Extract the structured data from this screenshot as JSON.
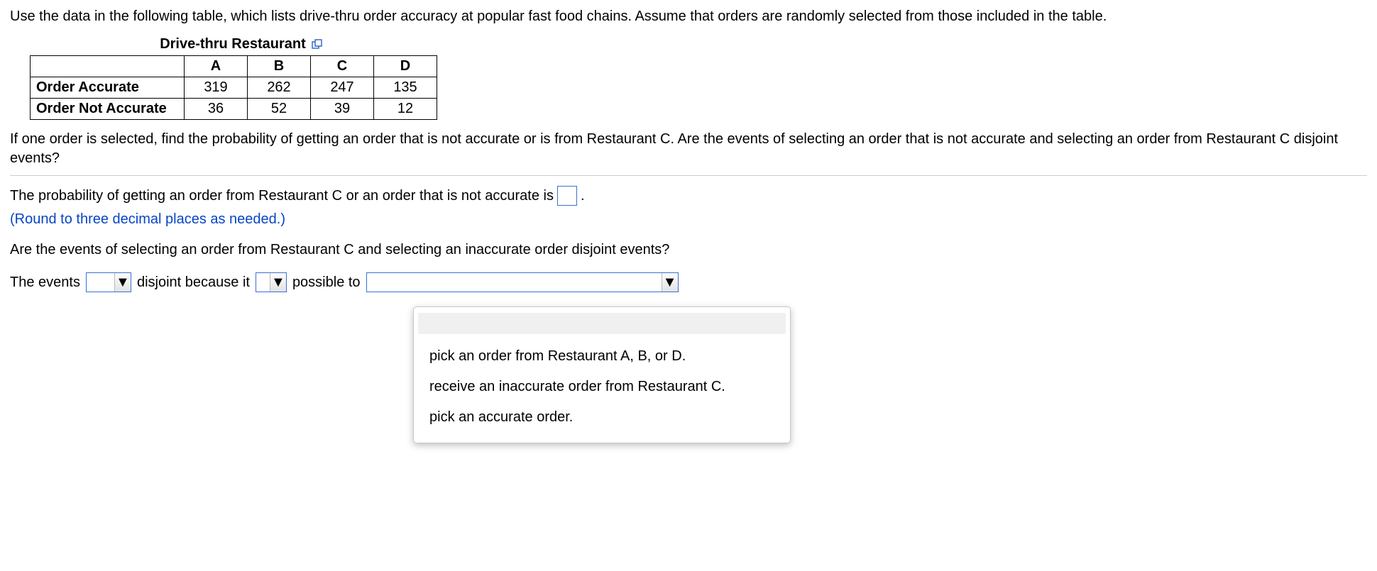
{
  "intro": "Use the data in the following table, which lists drive-thru order accuracy at popular fast food chains. Assume that orders are randomly selected from those included in the table.",
  "table": {
    "title": "Drive-thru Restaurant",
    "cols": [
      "A",
      "B",
      "C",
      "D"
    ],
    "rows": [
      {
        "label": "Order Accurate",
        "vals": [
          "319",
          "262",
          "247",
          "135"
        ]
      },
      {
        "label": "Order Not Accurate",
        "vals": [
          "36",
          "52",
          "39",
          "12"
        ]
      }
    ]
  },
  "question": "If one order is selected, find the probability of getting an order that is not accurate or is from Restaurant C. Are the events of selecting an order that is not accurate and selecting an order from Restaurant C disjoint events?",
  "answer": {
    "lead": "The probability of getting an order from Restaurant C or an order that is not accurate is",
    "trail": ".",
    "hint": "(Round to three decimal places as needed.)"
  },
  "q2": "Are the events of selecting an order from Restaurant C and selecting an inaccurate order disjoint events?",
  "sentence": {
    "p1": "The events",
    "p2": "disjoint because it",
    "p3": "possible to"
  },
  "dropdown_options": [
    "pick an order from Restaurant A, B, or D.",
    "receive an inaccurate order from Restaurant C.",
    "pick an accurate order."
  ]
}
